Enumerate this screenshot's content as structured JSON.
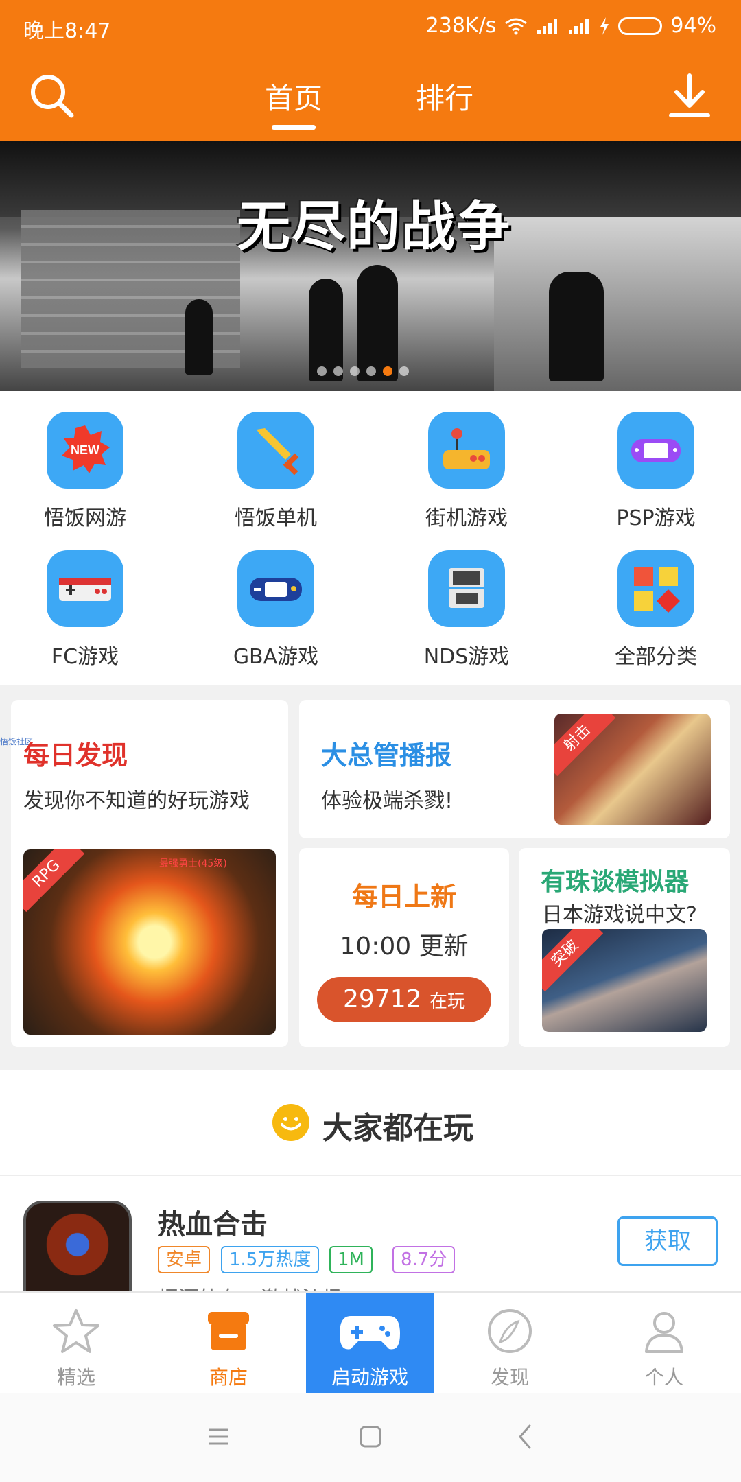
{
  "status_bar": {
    "time": "晚上8:47",
    "net_speed": "238K/s",
    "battery": "94%",
    "battery_level": 0.94,
    "battery_color": "#3cd64a"
  },
  "top_nav": {
    "tabs": [
      {
        "label": "首页",
        "active": true
      },
      {
        "label": "排行",
        "active": false
      }
    ],
    "accent_color": "#f57a10",
    "search_icon": "search-icon",
    "download_icon": "download-icon"
  },
  "banner": {
    "title": "无尽的战争",
    "slide_count": 6,
    "active_slide": 5
  },
  "categories": [
    {
      "label": "悟饭网游",
      "icon": "new-badge-icon"
    },
    {
      "label": "悟饭单机",
      "icon": "sword-icon"
    },
    {
      "label": "街机游戏",
      "icon": "arcade-joystick-icon"
    },
    {
      "label": "PSP游戏",
      "icon": "psp-console-icon"
    },
    {
      "label": "FC游戏",
      "icon": "fc-controller-icon"
    },
    {
      "label": "GBA游戏",
      "icon": "gba-console-icon"
    },
    {
      "label": "NDS游戏",
      "icon": "nds-console-icon"
    },
    {
      "label": "全部分类",
      "icon": "all-categories-icon"
    }
  ],
  "daily_discovery": {
    "title": "每日发现",
    "subtitle": "发现你不知道的好玩游戏",
    "badge": "RPG",
    "tiny_tag": "悟饭社区",
    "in_game_text": "最强勇士(45级)"
  },
  "manager_broadcast": {
    "title": "大总管播报",
    "subtitle": "体验极端杀戮!",
    "badge": "射击"
  },
  "daily_new": {
    "title": "每日上新",
    "update_time": "10:00 更新",
    "playing_count": "29712",
    "playing_label": "在玩"
  },
  "emulator_talk": {
    "title": "有珠谈模拟器",
    "subtitle": "日本游戏说中文?",
    "badge": "突破"
  },
  "everyone_playing": {
    "title": "大家都在玩",
    "apps": [
      {
        "name": "热血合击",
        "tags": [
          "安卓",
          "1.5万热度",
          "1M",
          "8.7分"
        ],
        "button": "获取",
        "description": "烟酒轨车，激战沙场"
      }
    ]
  },
  "bottom_nav": [
    {
      "label": "精选",
      "icon": "star-icon",
      "active": false
    },
    {
      "label": "商店",
      "icon": "store-icon",
      "active": true
    },
    {
      "label": "启动游戏",
      "icon": "gamepad-icon",
      "active": false
    },
    {
      "label": "发现",
      "icon": "compass-icon",
      "active": false
    },
    {
      "label": "个人",
      "icon": "person-icon",
      "active": false
    }
  ]
}
